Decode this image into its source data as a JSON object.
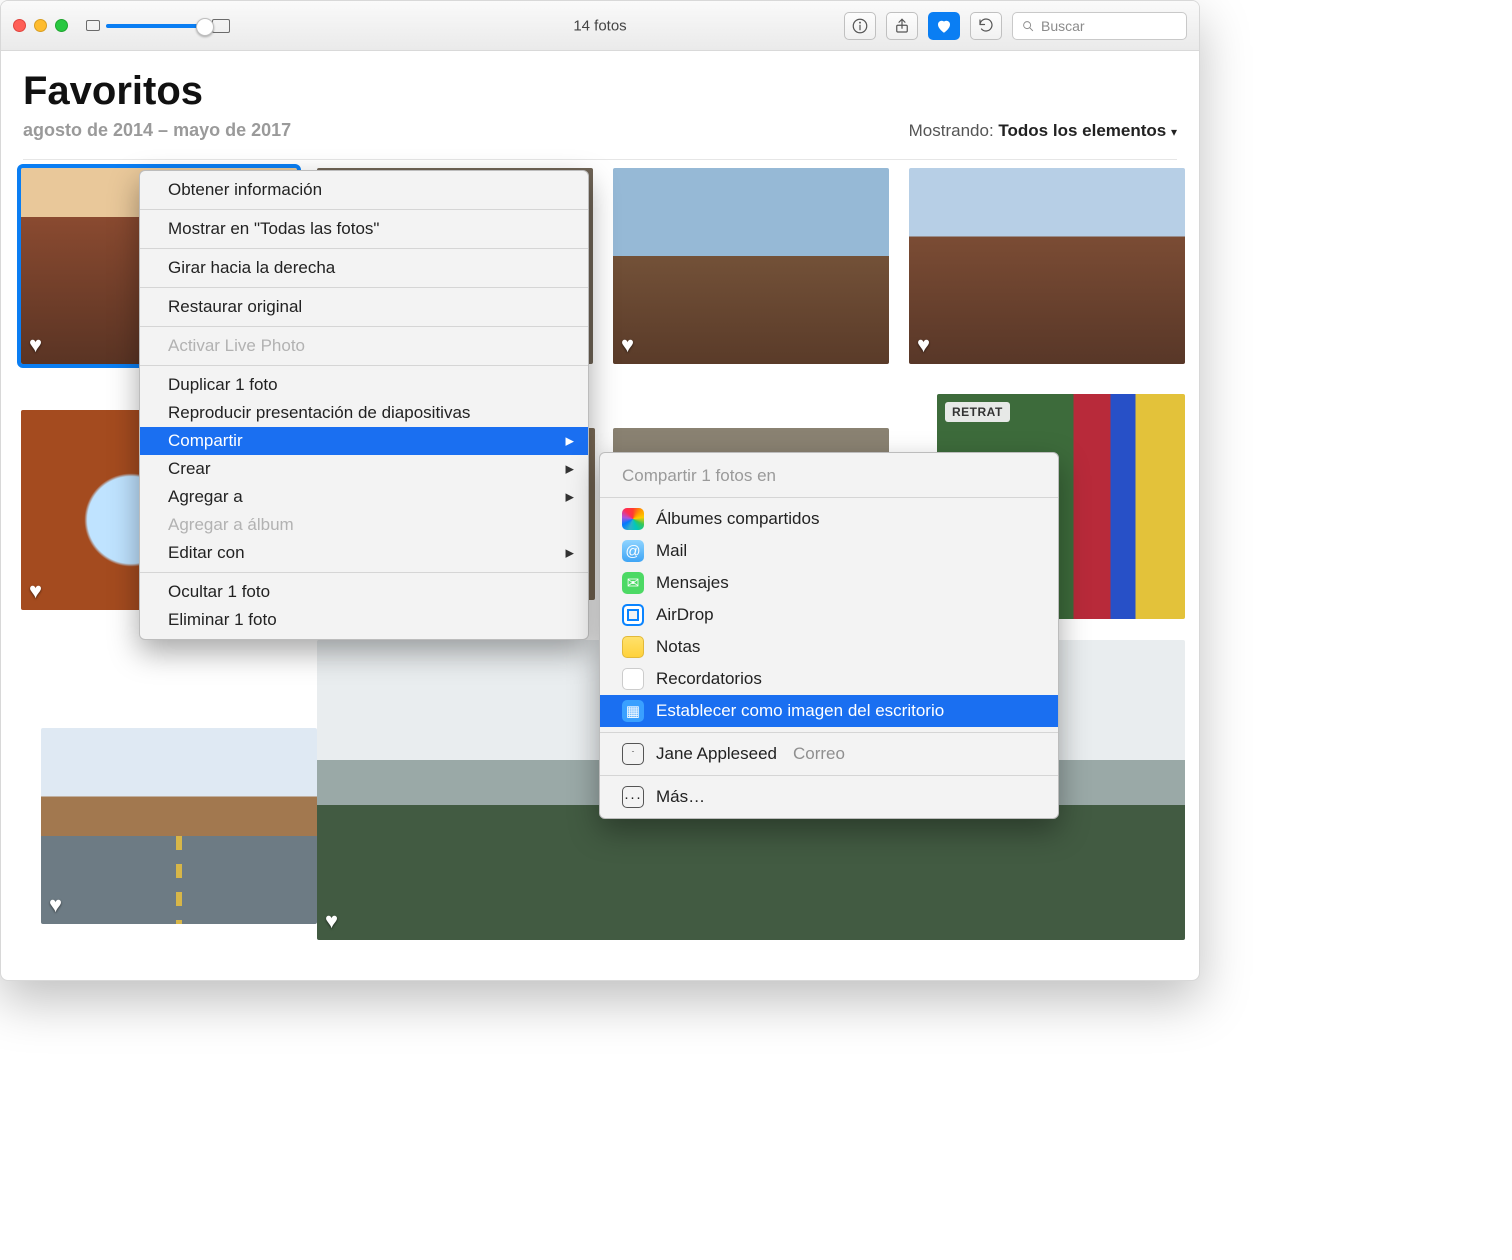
{
  "titlebar": {
    "title": "14 fotos",
    "search_placeholder": "Buscar"
  },
  "header": {
    "title": "Favoritos",
    "date_range": "agosto de 2014 – mayo de 2017",
    "showing_label": "Mostrando:",
    "showing_value": "Todos los elementos"
  },
  "thumbs": {
    "retrat_badge": "RETRAT"
  },
  "context_menu": {
    "get_info": "Obtener información",
    "show_in_all": "Mostrar en \"Todas las fotos\"",
    "rotate_right": "Girar hacia la derecha",
    "revert_original": "Restaurar original",
    "enable_live_photo": "Activar Live Photo",
    "duplicate": "Duplicar 1 foto",
    "play_slideshow": "Reproducir presentación de diapositivas",
    "share": "Compartir",
    "create": "Crear",
    "add_to": "Agregar a",
    "add_to_album": "Agregar a álbum",
    "edit_with": "Editar con",
    "hide": "Ocultar 1 foto",
    "delete": "Eliminar 1 foto"
  },
  "share_submenu": {
    "header": "Compartir 1 fotos en",
    "shared_albums": "Álbumes compartidos",
    "mail": "Mail",
    "messages": "Mensajes",
    "airdrop": "AirDrop",
    "notes": "Notas",
    "reminders": "Recordatorios",
    "set_desktop": "Establecer como imagen del escritorio",
    "contact_name": "Jane Appleseed",
    "contact_via": "Correo",
    "more": "Más…"
  }
}
